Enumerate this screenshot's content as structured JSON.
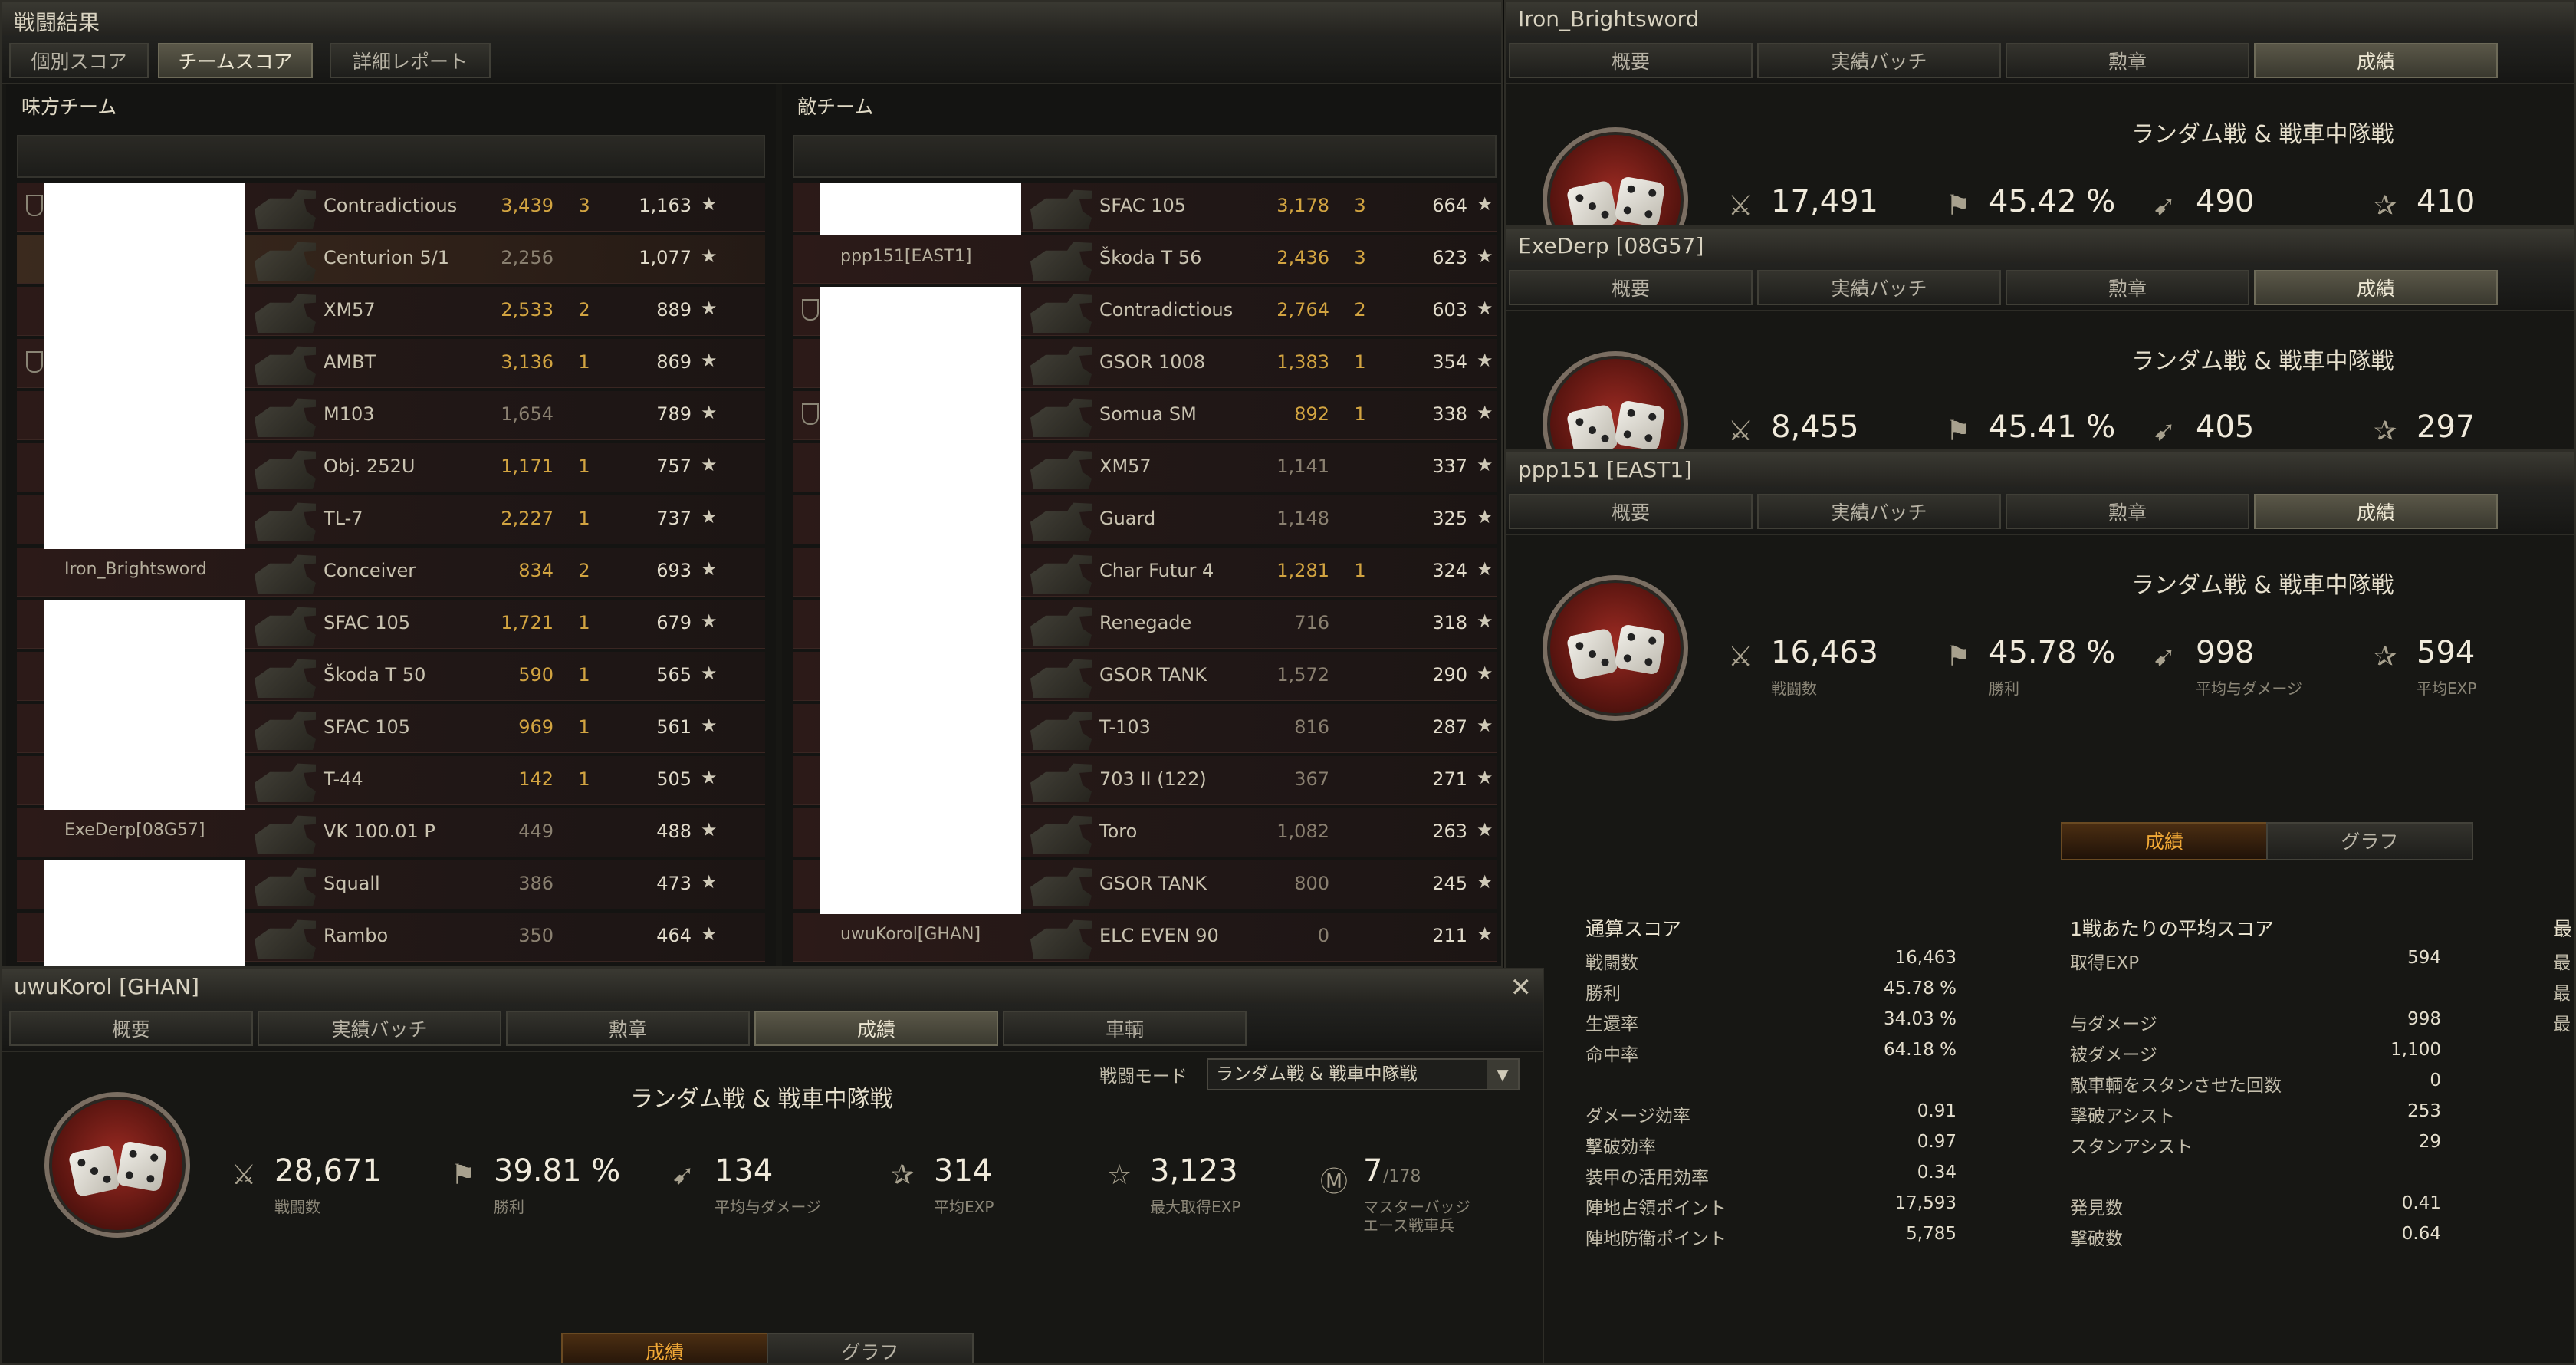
{
  "battle": {
    "title": "戦闘結果",
    "tabs": [
      "個別スコア",
      "チームスコア",
      "詳細レポート"
    ],
    "ally_title": "味方チーム",
    "enemy_title": "敵チーム",
    "ally_rows": [
      {
        "player": "",
        "tank": "Contradictious",
        "damage": "3,439",
        "kills": "3",
        "exp": "1,163"
      },
      {
        "player": "",
        "tank": "Centurion 5/1",
        "damage": "2,256",
        "kills": "",
        "exp": "1,077"
      },
      {
        "player": "",
        "tank": "XM57",
        "damage": "2,533",
        "kills": "2",
        "exp": "889"
      },
      {
        "player": "",
        "tank": "AMBT",
        "damage": "3,136",
        "kills": "1",
        "exp": "869"
      },
      {
        "player": "",
        "tank": "M103",
        "damage": "1,654",
        "kills": "",
        "exp": "789"
      },
      {
        "player": "",
        "tank": "Obj. 252U",
        "damage": "1,171",
        "kills": "1",
        "exp": "757"
      },
      {
        "player": "",
        "tank": "TL-7",
        "damage": "2,227",
        "kills": "1",
        "exp": "737"
      },
      {
        "player": "Iron_Brightsword",
        "tank": "Conceiver",
        "damage": "834",
        "kills": "2",
        "exp": "693"
      },
      {
        "player": "",
        "tank": "SFAC 105",
        "damage": "1,721",
        "kills": "1",
        "exp": "679"
      },
      {
        "player": "",
        "tank": "Škoda T 50",
        "damage": "590",
        "kills": "1",
        "exp": "565"
      },
      {
        "player": "",
        "tank": "SFAC 105",
        "damage": "969",
        "kills": "1",
        "exp": "561"
      },
      {
        "player": "",
        "tank": "T-44",
        "damage": "142",
        "kills": "1",
        "exp": "505"
      },
      {
        "player": "ExeDerp[08G57]",
        "tank": "VK 100.01 P",
        "damage": "449",
        "kills": "",
        "exp": "488"
      },
      {
        "player": "",
        "tank": "Squall",
        "damage": "386",
        "kills": "",
        "exp": "473"
      },
      {
        "player": "",
        "tank": "Rambo",
        "damage": "350",
        "kills": "",
        "exp": "464"
      }
    ],
    "enemy_rows": [
      {
        "player": "",
        "tank": "SFAC 105",
        "damage": "3,178",
        "kills": "3",
        "exp": "664"
      },
      {
        "player": "ppp151[EAST1]",
        "tank": "Škoda T 56",
        "damage": "2,436",
        "kills": "3",
        "exp": "623"
      },
      {
        "player": "",
        "tank": "Contradictious",
        "damage": "2,764",
        "kills": "2",
        "exp": "603"
      },
      {
        "player": "",
        "tank": "GSOR 1008",
        "damage": "1,383",
        "kills": "1",
        "exp": "354"
      },
      {
        "player": "",
        "tank": "Somua SM",
        "damage": "892",
        "kills": "1",
        "exp": "338"
      },
      {
        "player": "",
        "tank": "XM57",
        "damage": "1,141",
        "kills": "",
        "exp": "337"
      },
      {
        "player": "",
        "tank": "Guard",
        "damage": "1,148",
        "kills": "",
        "exp": "325"
      },
      {
        "player": "",
        "tank": "Char Futur 4",
        "damage": "1,281",
        "kills": "1",
        "exp": "324"
      },
      {
        "player": "",
        "tank": "Renegade",
        "damage": "716",
        "kills": "",
        "exp": "318"
      },
      {
        "player": "",
        "tank": "GSOR TANK",
        "damage": "1,572",
        "kills": "",
        "exp": "290"
      },
      {
        "player": "",
        "tank": "T-103",
        "damage": "816",
        "kills": "",
        "exp": "287"
      },
      {
        "player": "",
        "tank": "703 II (122)",
        "damage": "367",
        "kills": "",
        "exp": "271"
      },
      {
        "player": "",
        "tank": "Toro",
        "damage": "1,082",
        "kills": "",
        "exp": "263"
      },
      {
        "player": "",
        "tank": "GSOR TANK",
        "damage": "800",
        "kills": "",
        "exp": "245"
      },
      {
        "player": "uwuKorol[GHAN]",
        "tank": "ELC EVEN 90",
        "damage": "0",
        "kills": "",
        "exp": "211"
      }
    ]
  },
  "profile_tabs": [
    "概要",
    "実績バッチ",
    "勲章",
    "成績"
  ],
  "mode_title": "ランダム戦 & 戦車中隊戦",
  "p_iron": {
    "title": "Iron_Brightsword",
    "battles": "17,491",
    "winrate": "45.42 %",
    "avg_dmg": "490",
    "avg_exp": "410"
  },
  "p_exe": {
    "title": "ExeDerp [08G57]",
    "battles": "8,455",
    "winrate": "45.41 %",
    "avg_dmg": "405",
    "avg_exp": "297"
  },
  "p_ppp": {
    "title": "ppp151 [EAST1]",
    "battles": "16,463",
    "winrate": "45.78 %",
    "avg_dmg": "998",
    "avg_exp": "594",
    "lbl_battles": "戦闘数",
    "lbl_win": "勝利",
    "lbl_dmg": "平均与ダメージ",
    "lbl_exp": "平均EXP",
    "toggle_on": "成績",
    "toggle_off": "グラフ",
    "total_head": "通算スコア",
    "total": [
      {
        "k": "戦闘数",
        "v": "16,463"
      },
      {
        "k": "勝利",
        "v": "45.78 %"
      },
      {
        "k": "生還率",
        "v": "34.03 %"
      },
      {
        "k": "命中率",
        "v": "64.18 %"
      },
      {
        "k": "ダメージ効率",
        "v": "0.91"
      },
      {
        "k": "撃破効率",
        "v": "0.97"
      },
      {
        "k": "装甲の活用効率",
        "v": "0.34"
      },
      {
        "k": "陣地占領ポイント",
        "v": "17,593"
      },
      {
        "k": "陣地防衛ポイント",
        "v": "5,785"
      }
    ],
    "avg_head": "1戦あたりの平均スコア",
    "avg": [
      {
        "k": "取得EXP",
        "v": "594"
      },
      {
        "k": "与ダメージ",
        "v": "998"
      },
      {
        "k": "被ダメージ",
        "v": "1,100"
      },
      {
        "k": "敵車輌をスタンさせた回数",
        "v": "0"
      },
      {
        "k": "撃破アシスト",
        "v": "253"
      },
      {
        "k": "スタンアシスト",
        "v": "29"
      },
      {
        "k": "発見数",
        "v": "0.41"
      },
      {
        "k": "撃破数",
        "v": "0.64"
      }
    ],
    "max_head": "最",
    "max_chars": [
      "最",
      "最",
      "最"
    ]
  },
  "p_uwu": {
    "title": "uwuKorol [GHAN]",
    "tabs": [
      "概要",
      "実績バッチ",
      "勲章",
      "成績",
      "車輌"
    ],
    "mode_label": "戦闘モード",
    "mode_value": "ランダム戦 & 戦車中隊戦",
    "battles": "28,671",
    "winrate": "39.81 %",
    "avg_dmg": "134",
    "avg_exp": "314",
    "max_exp": "3,123",
    "badges": "7",
    "badges_total": "/178",
    "lbl_battles": "戦闘数",
    "lbl_win": "勝利",
    "lbl_dmg": "平均与ダメージ",
    "lbl_exp": "平均EXP",
    "lbl_max": "最大取得EXP",
    "lbl_badge1": "マスターバッジ",
    "lbl_badge2": "エース戦車兵",
    "toggle_on": "成績",
    "toggle_off": "グラフ"
  },
  "colors": {
    "accent": "#f0a836",
    "damage": "#d2a441",
    "row_red": "#2c1a18"
  }
}
